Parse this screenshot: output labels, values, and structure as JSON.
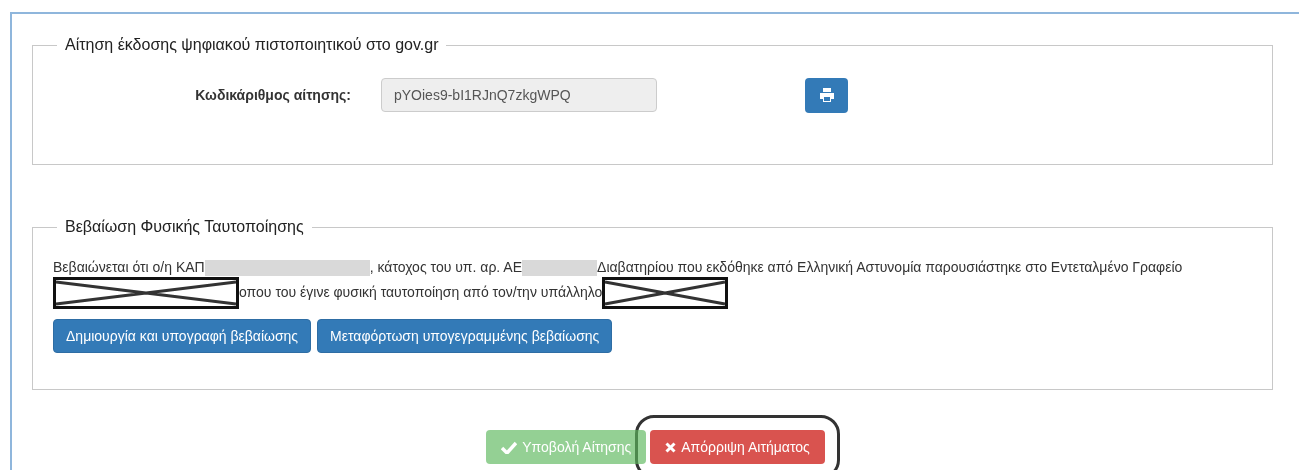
{
  "application_section": {
    "legend": "Αίτηση έκδοσης ψηφιακού πιστοποιητικού στο gov.gr",
    "code_label": "Κωδικάριθμος αίτησης:",
    "code_field": {
      "value": "pYOies9-bI1RJnQ7zkgWPQ",
      "disabled": true
    }
  },
  "verification_section": {
    "legend": "Βεβαίωση Φυσικής Ταυτοποίησης",
    "statement": [
      {
        "kind": "text",
        "text": "Βεβαιώνεται ότι ο/η ΚΑΠ"
      },
      {
        "kind": "blur"
      },
      {
        "kind": "text",
        "text": ", κάτοχος του υπ. αρ. ΑΕ"
      },
      {
        "kind": "blur"
      },
      {
        "kind": "text",
        "text": "Διαβατηρίου που εκδόθηκε από Ελληνική Αστυνομία παρουσιάστηκε στο Εντεταλμένο Γραφείο"
      },
      {
        "kind": "cross"
      },
      {
        "kind": "text",
        "text": "οπου του έγινε φυσική ταυτοποίηση από τον/την υπάλληλο"
      },
      {
        "kind": "cross"
      }
    ],
    "buttons": [
      {
        "label": "Δημιουργία και υπογραφή βεβαίωσης"
      },
      {
        "label": "Μεταφόρτωση υπογεγραμμένης βεβαίωσης"
      }
    ]
  },
  "footer_buttons": [
    {
      "kind": "submit",
      "label": "Υποβολή Αίτησης",
      "disabled": true,
      "highlighted": false
    },
    {
      "kind": "reject",
      "label": "Απόρριψη Αιτήματος",
      "disabled": false,
      "highlighted": true
    }
  ]
}
